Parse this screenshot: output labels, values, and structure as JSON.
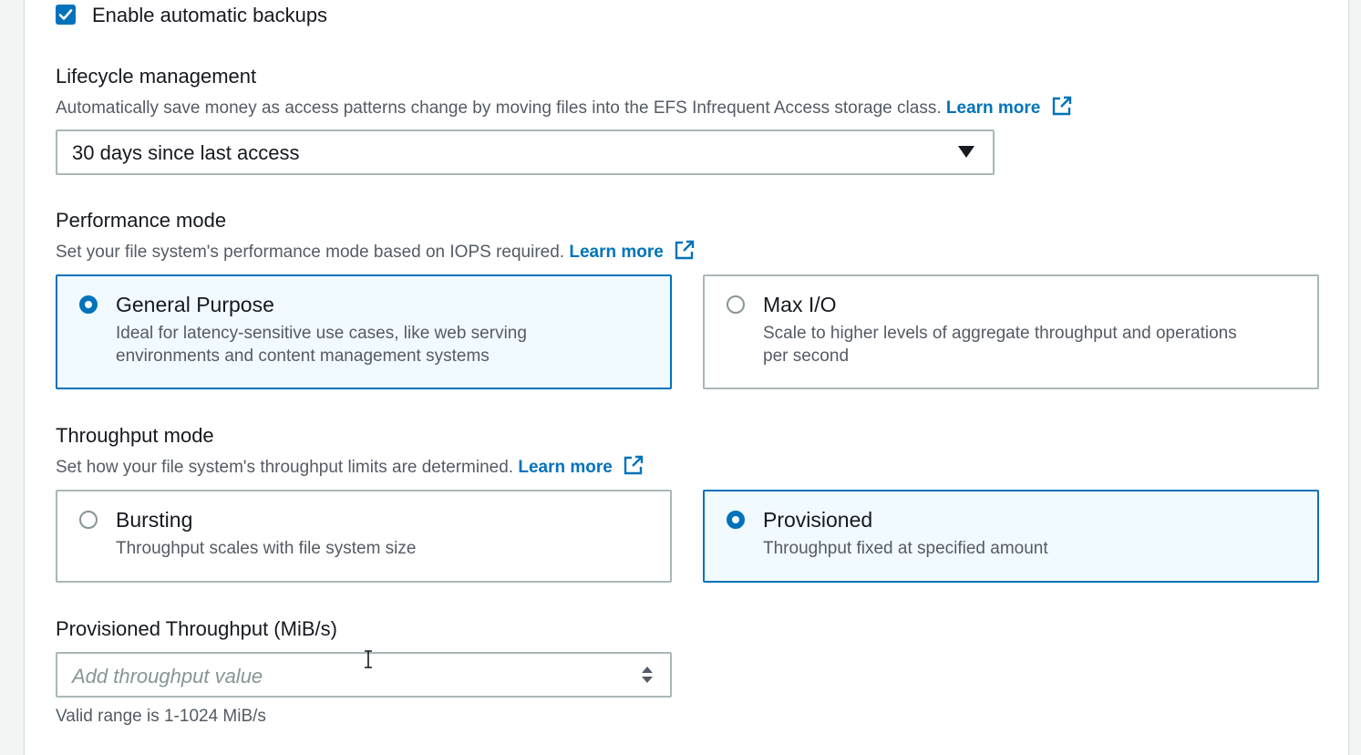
{
  "backups": {
    "label": "Enable automatic backups",
    "checked": true
  },
  "lifecycle": {
    "title": "Lifecycle management",
    "description": "Automatically save money as access patterns change by moving files into the EFS Infrequent Access storage class.",
    "link": "Learn more",
    "selected": "30 days since last access"
  },
  "performance": {
    "title": "Performance mode",
    "description": "Set your file system's performance mode based on IOPS required.",
    "link": "Learn more",
    "options": [
      {
        "title": "General Purpose",
        "desc1": "Ideal for latency-sensitive use cases, like web serving",
        "desc2": "environments and content management systems",
        "selected": true
      },
      {
        "title": "Max I/O",
        "desc1": "Scale to higher levels of aggregate throughput and operations",
        "desc2": "per second",
        "selected": false
      }
    ]
  },
  "throughput": {
    "title": "Throughput mode",
    "description": "Set how your file system's throughput limits are determined.",
    "link": "Learn more",
    "options": [
      {
        "title": "Bursting",
        "desc": "Throughput scales with file system size",
        "selected": false
      },
      {
        "title": "Provisioned",
        "desc": "Throughput fixed at specified amount",
        "selected": true
      }
    ]
  },
  "provisioned": {
    "label": "Provisioned Throughput (MiB/s)",
    "placeholder": "Add throughput value",
    "hint": "Valid range is 1-1024 MiB/s"
  },
  "colors": {
    "accent": "#0073bb",
    "selected_tile_bg": "#f1faff",
    "border": "#aab7b8",
    "secondary_text": "#545b64"
  },
  "icons": {
    "checkbox": "check-icon",
    "external_link": "external-link-icon",
    "dropdown": "caret-down-icon",
    "stepper": "number-stepper-icon",
    "cursor": "text-cursor-icon"
  }
}
